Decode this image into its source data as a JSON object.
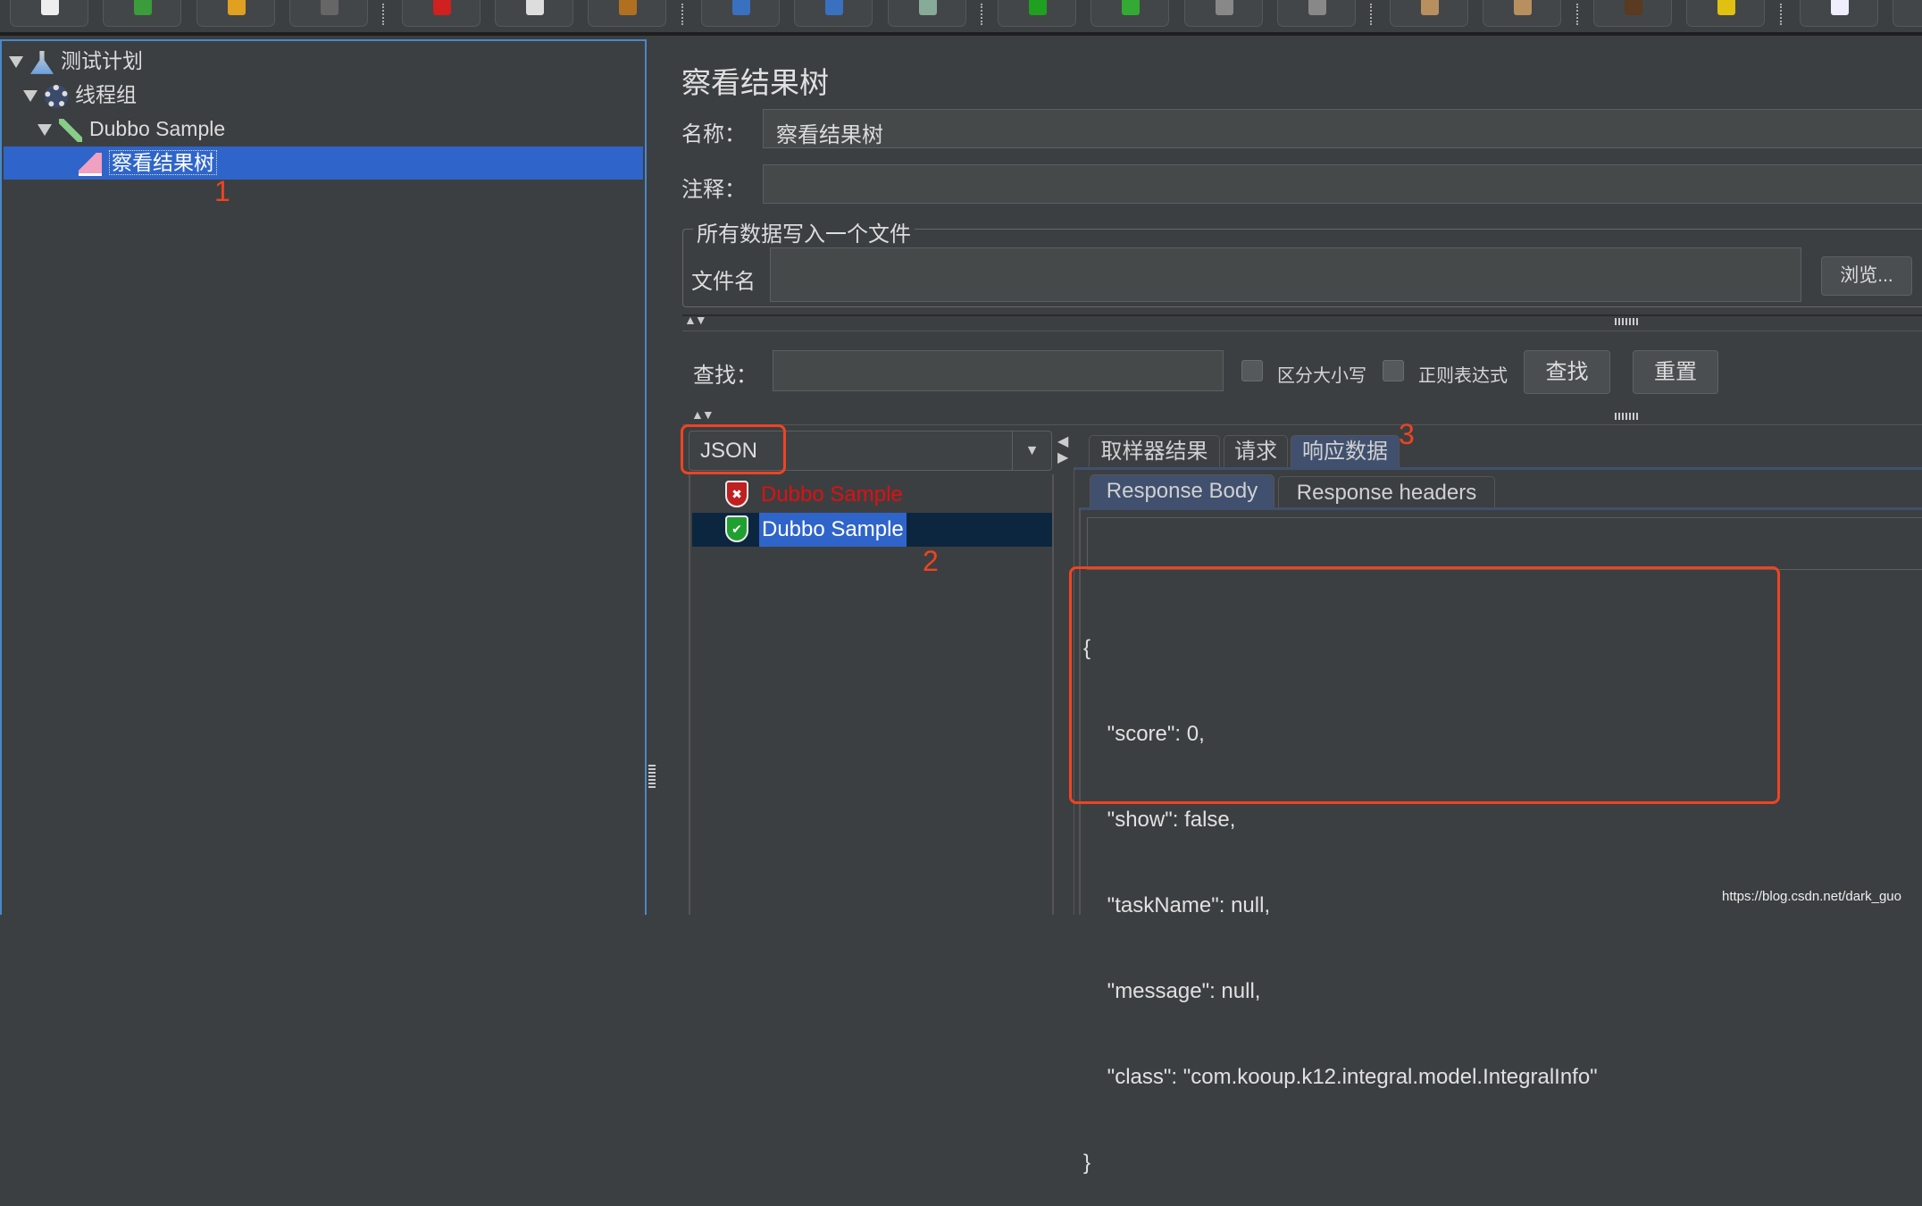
{
  "toolbar": {
    "buttons": [
      "new",
      "templates",
      "open",
      "save",
      "cut",
      "copy",
      "paste",
      "expand",
      "collapse",
      "toggle",
      "start",
      "start-no-pause",
      "stop",
      "shutdown",
      "clear",
      "clear-all",
      "search",
      "reset-search",
      "function-helper",
      "help"
    ]
  },
  "tree": {
    "items": [
      {
        "label": "测试计划",
        "icon": "flask-icon"
      },
      {
        "label": "线程组",
        "icon": "gear-icon"
      },
      {
        "label": "Dubbo Sample",
        "icon": "pipette-icon"
      },
      {
        "label": "察看结果树",
        "icon": "chart-icon",
        "selected": true
      }
    ]
  },
  "annotations": {
    "a1": "1",
    "a2": "2",
    "a3": "3"
  },
  "panel": {
    "title": "察看结果树",
    "name_label": "名称：",
    "name_value": "察看结果树",
    "comment_label": "注释：",
    "comment_value": "",
    "file_group": "所有数据写入一个文件",
    "filename_label": "文件名",
    "filename_value": "",
    "browse": "浏览...",
    "search_label": "查找：",
    "search_value": "",
    "case_label": "区分大小写",
    "regex_label": "正则表达式",
    "find_btn": "查找",
    "reset_btn": "重置",
    "renderer": "JSON",
    "results": [
      {
        "label": "Dubbo Sample",
        "status": "error"
      },
      {
        "label": "Dubbo Sample",
        "status": "success",
        "selected": true
      }
    ],
    "tabs": [
      "取样器结果",
      "请求",
      "响应数据"
    ],
    "active_tab": "响应数据",
    "subtabs": [
      "Response Body",
      "Response headers"
    ],
    "active_subtab": "Response Body",
    "json_lines": [
      "{",
      "    \"score\": 0,",
      "    \"show\": false,",
      "    \"taskName\": null,",
      "    \"message\": null,",
      "    \"class\": \"com.kooup.k12.integral.model.IntegralInfo\"",
      "}"
    ]
  },
  "watermark": "https://blog.csdn.net/dark_guo",
  "colors": {
    "accent": "#4a88c7",
    "selection": "#2f65ca",
    "annotation": "#ee4422",
    "error_text": "#e01010"
  }
}
